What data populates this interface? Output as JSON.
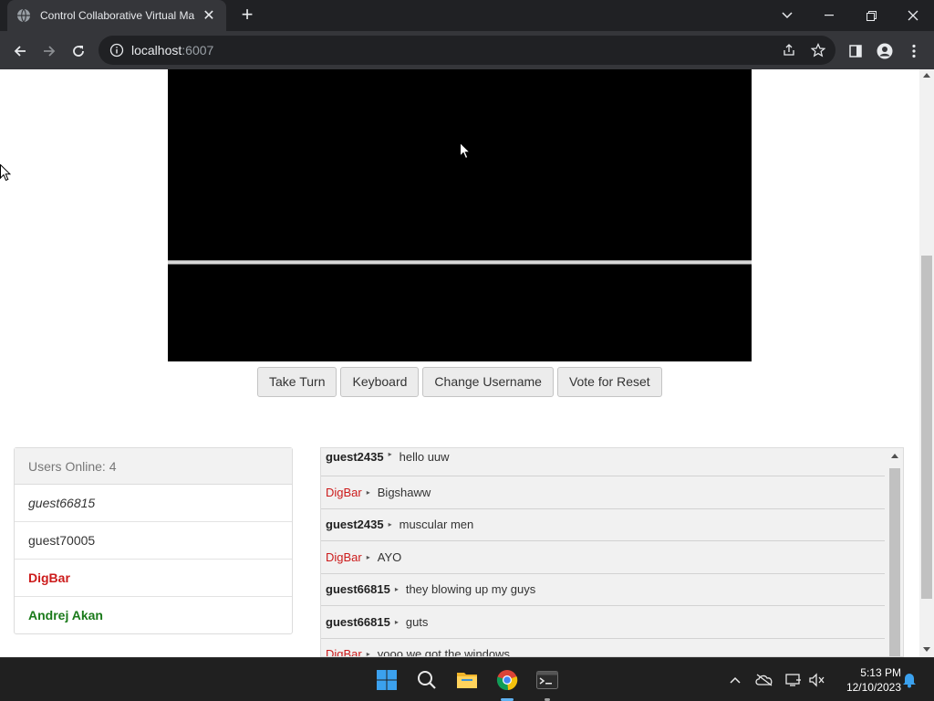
{
  "browser": {
    "tab_title": "Control Collaborative Virtual Ma",
    "url_host": "localhost",
    "url_port": ":6007"
  },
  "controls": {
    "take_turn": "Take Turn",
    "keyboard": "Keyboard",
    "change_username": "Change Username",
    "vote_reset": "Vote for Reset"
  },
  "users": {
    "header": "Users Online: 4",
    "list": [
      {
        "name": "guest66815",
        "color": "#333333",
        "style": "italic"
      },
      {
        "name": "guest70005",
        "color": "#333333",
        "style": "normal"
      },
      {
        "name": "DigBar",
        "color": "#cc1b1b",
        "style": "bold"
      },
      {
        "name": "Andrej Akan",
        "color": "#1a7a1a",
        "style": "bold"
      }
    ]
  },
  "chat": {
    "separator": "▸",
    "messages": [
      {
        "user": "guest2435",
        "text": "hello uuw",
        "admin": false
      },
      {
        "user": "DigBar",
        "text": "Bigshaww",
        "admin": true
      },
      {
        "user": "guest2435",
        "text": "muscular men",
        "admin": false
      },
      {
        "user": "DigBar",
        "text": "AYO",
        "admin": true
      },
      {
        "user": "guest66815",
        "text": "they blowing up my guys",
        "admin": false
      },
      {
        "user": "guest66815",
        "text": "guts",
        "admin": false
      },
      {
        "user": "DigBar",
        "text": "yooo we got the windows",
        "admin": true
      }
    ]
  },
  "clock": {
    "time": "5:13 PM",
    "date": "12/10/2023"
  },
  "colors": {
    "admin": "#cc1b1b",
    "moderator": "#1a7a1a",
    "accent": "#5fb2f2"
  }
}
